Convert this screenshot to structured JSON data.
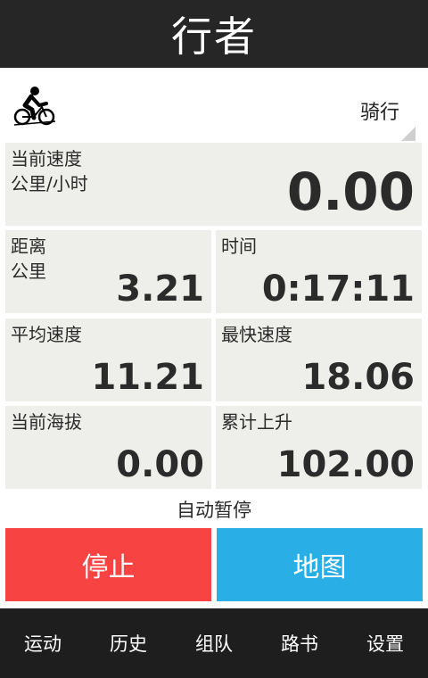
{
  "app": {
    "title": "行者"
  },
  "sport": {
    "mode_label": "骑行",
    "icon": "cycling-icon"
  },
  "metrics": {
    "current_speed": {
      "label": "当前速度",
      "unit": "公里/小时",
      "value": "0.00"
    },
    "distance": {
      "label": "距离",
      "unit": "公里",
      "value": "3.21"
    },
    "time": {
      "label": "时间",
      "value": "0:17:11"
    },
    "avg_speed": {
      "label": "平均速度",
      "value": "11.21"
    },
    "max_speed": {
      "label": "最快速度",
      "value": "18.06"
    },
    "altitude": {
      "label": "当前海拔",
      "value": "0.00"
    },
    "ascent": {
      "label": "累计上升",
      "value": "102.00"
    }
  },
  "auto_pause": {
    "label": "自动暂停"
  },
  "buttons": {
    "stop": {
      "label": "停止",
      "color": "#f84343"
    },
    "map": {
      "label": "地图",
      "color": "#29aee6"
    }
  },
  "nav": {
    "items": [
      {
        "label": "运动"
      },
      {
        "label": "历史"
      },
      {
        "label": "组队"
      },
      {
        "label": "路书"
      },
      {
        "label": "设置"
      }
    ]
  }
}
